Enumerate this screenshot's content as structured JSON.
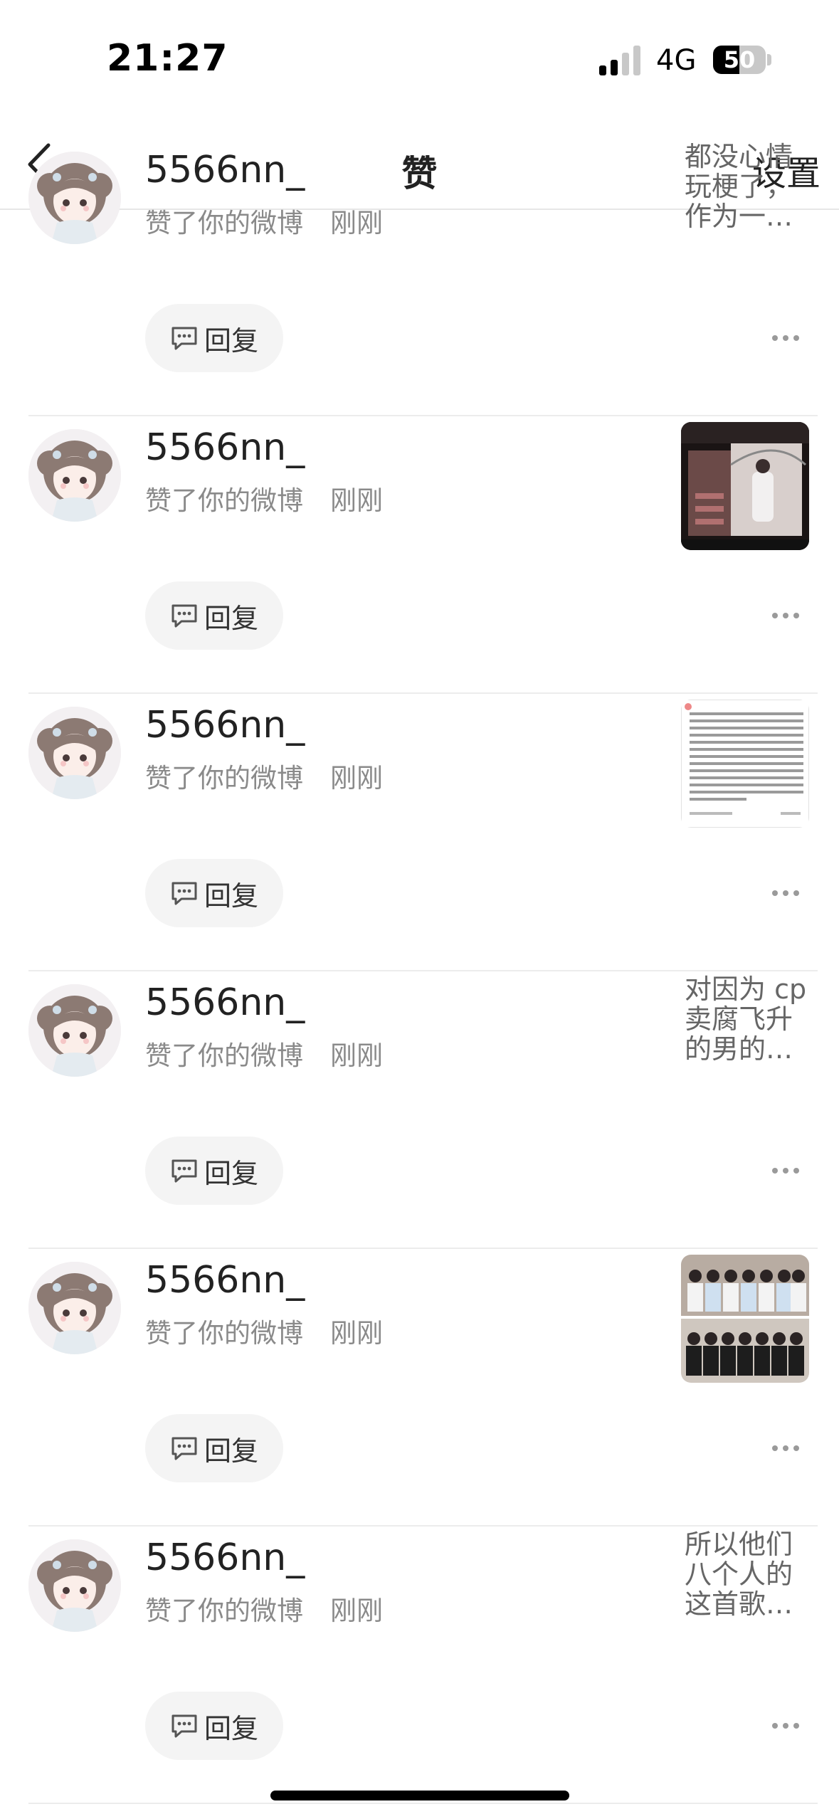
{
  "status_bar": {
    "time": "21:27",
    "network": "4G",
    "battery": "50",
    "battery_level": 0.5
  },
  "nav": {
    "title": "赞",
    "settings": "设置"
  },
  "colors": {
    "background": "#ffffff",
    "secondary_text": "#8a8a8a",
    "reply_bg": "#f4f4f4",
    "divider": "#ececec"
  },
  "notifications": [
    {
      "user": "5566nn_",
      "action": "赞了你的微博",
      "time": "刚刚",
      "preview_type": "text",
      "preview_lines": [
        "都没心情",
        "玩梗了，",
        "作为一…"
      ],
      "reply_label": "回复"
    },
    {
      "user": "5566nn_",
      "action": "赞了你的微博",
      "time": "刚刚",
      "preview_type": "image",
      "image": "photo-stairs",
      "reply_label": "回复"
    },
    {
      "user": "5566nn_",
      "action": "赞了你的微博",
      "time": "刚刚",
      "preview_type": "image",
      "image": "screenshot-text-post",
      "reply_label": "回复"
    },
    {
      "user": "5566nn_",
      "action": "赞了你的微博",
      "time": "刚刚",
      "preview_type": "text",
      "preview_lines": [
        "对因为 cp",
        "卖腐飞升",
        "的男的…"
      ],
      "reply_label": "回复"
    },
    {
      "user": "5566nn_",
      "action": "赞了你的微博",
      "time": "刚刚",
      "preview_type": "image",
      "image": "group-photo",
      "reply_label": "回复"
    },
    {
      "user": "5566nn_",
      "action": "赞了你的微博",
      "time": "刚刚",
      "preview_type": "text",
      "preview_lines": [
        "所以他们",
        "八个人的",
        "这首歌…"
      ],
      "reply_label": "回复"
    }
  ]
}
